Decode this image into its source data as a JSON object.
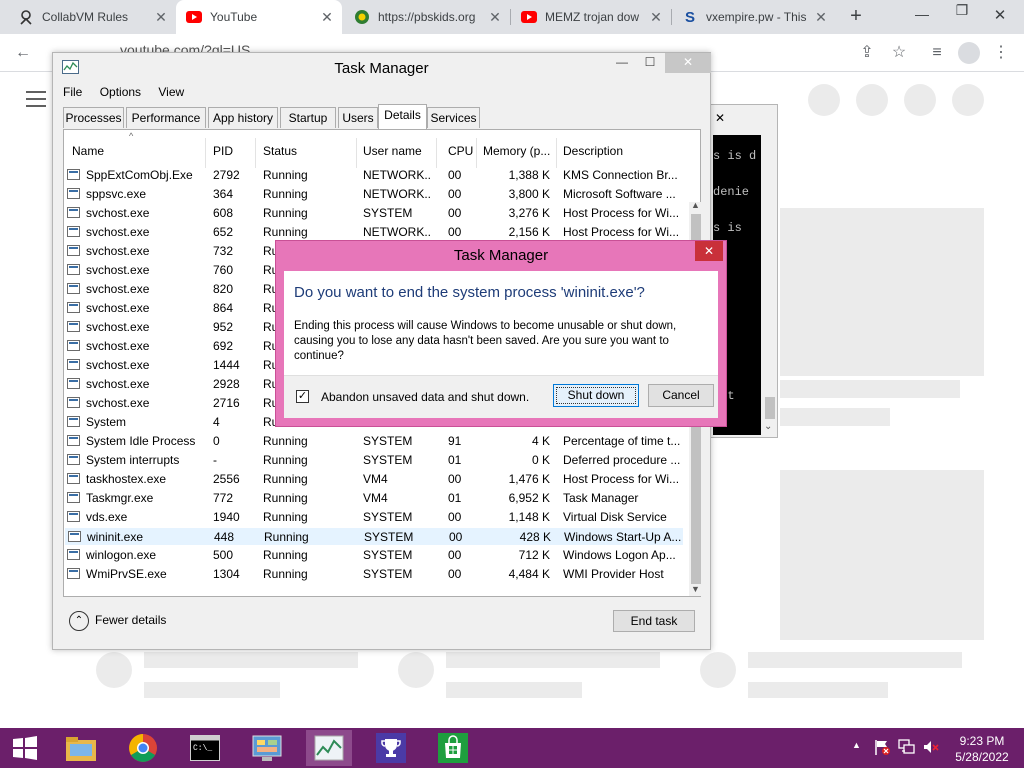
{
  "browser": {
    "tabs": [
      {
        "title": "CollabVM Rules",
        "icon": "collabvm-icon"
      },
      {
        "title": "YouTube",
        "icon": "youtube-icon"
      },
      {
        "title": "https://pbskids.org",
        "icon": "pbskids-icon"
      },
      {
        "title": "MEMZ trojan dow",
        "icon": "youtube-icon"
      },
      {
        "title": "vxempire.pw - This",
        "icon": "vxempire-icon"
      }
    ],
    "new_tab": "+",
    "url": "youtube.com/?gl=US",
    "colors": {
      "tabstrip": "#dfe1e5",
      "active_tab": "#ffffff"
    }
  },
  "task_manager": {
    "title": "Task Manager",
    "menu": [
      "File",
      "Options",
      "View"
    ],
    "tabs": [
      "Processes",
      "Performance",
      "App history",
      "Startup",
      "Users",
      "Details",
      "Services"
    ],
    "selected_tab": "Details",
    "columns": [
      "Name",
      "PID",
      "Status",
      "User name",
      "CPU",
      "Memory (p...",
      "Description"
    ],
    "rows": [
      {
        "name": "SppExtComObj.Exe",
        "pid": "2792",
        "status": "Running",
        "user": "NETWORK...",
        "cpu": "00",
        "mem": "1,388 K",
        "desc": "KMS Connection Br..."
      },
      {
        "name": "sppsvc.exe",
        "pid": "364",
        "status": "Running",
        "user": "NETWORK...",
        "cpu": "00",
        "mem": "3,800 K",
        "desc": "Microsoft Software ..."
      },
      {
        "name": "svchost.exe",
        "pid": "608",
        "status": "Running",
        "user": "SYSTEM",
        "cpu": "00",
        "mem": "3,276 K",
        "desc": "Host Process for Wi..."
      },
      {
        "name": "svchost.exe",
        "pid": "652",
        "status": "Running",
        "user": "NETWORK...",
        "cpu": "00",
        "mem": "2,156 K",
        "desc": "Host Process for Wi..."
      },
      {
        "name": "svchost.exe",
        "pid": "732",
        "status": "Ru",
        "user": "",
        "cpu": "",
        "mem": "",
        "desc": ""
      },
      {
        "name": "svchost.exe",
        "pid": "760",
        "status": "Ru",
        "user": "",
        "cpu": "",
        "mem": "",
        "desc": ""
      },
      {
        "name": "svchost.exe",
        "pid": "820",
        "status": "Ru",
        "user": "",
        "cpu": "",
        "mem": "",
        "desc": ""
      },
      {
        "name": "svchost.exe",
        "pid": "864",
        "status": "Ru",
        "user": "",
        "cpu": "",
        "mem": "",
        "desc": ""
      },
      {
        "name": "svchost.exe",
        "pid": "952",
        "status": "Ru",
        "user": "",
        "cpu": "",
        "mem": "",
        "desc": ""
      },
      {
        "name": "svchost.exe",
        "pid": "692",
        "status": "Ru",
        "user": "",
        "cpu": "",
        "mem": "",
        "desc": ""
      },
      {
        "name": "svchost.exe",
        "pid": "1444",
        "status": "Ru",
        "user": "",
        "cpu": "",
        "mem": "",
        "desc": ""
      },
      {
        "name": "svchost.exe",
        "pid": "2928",
        "status": "Ru",
        "user": "",
        "cpu": "",
        "mem": "",
        "desc": ""
      },
      {
        "name": "svchost.exe",
        "pid": "2716",
        "status": "Ru",
        "user": "",
        "cpu": "",
        "mem": "",
        "desc": ""
      },
      {
        "name": "System",
        "pid": "4",
        "status": "Ru",
        "user": "",
        "cpu": "",
        "mem": "",
        "desc": ""
      },
      {
        "name": "System Idle Process",
        "pid": "0",
        "status": "Running",
        "user": "SYSTEM",
        "cpu": "91",
        "mem": "4 K",
        "desc": "Percentage of time t..."
      },
      {
        "name": "System interrupts",
        "pid": "-",
        "status": "Running",
        "user": "SYSTEM",
        "cpu": "01",
        "mem": "0 K",
        "desc": "Deferred procedure ..."
      },
      {
        "name": "taskhostex.exe",
        "pid": "2556",
        "status": "Running",
        "user": "VM4",
        "cpu": "00",
        "mem": "1,476 K",
        "desc": "Host Process for Wi..."
      },
      {
        "name": "Taskmgr.exe",
        "pid": "772",
        "status": "Running",
        "user": "VM4",
        "cpu": "01",
        "mem": "6,952 K",
        "desc": "Task Manager"
      },
      {
        "name": "vds.exe",
        "pid": "1940",
        "status": "Running",
        "user": "SYSTEM",
        "cpu": "00",
        "mem": "1,148 K",
        "desc": "Virtual Disk Service"
      },
      {
        "name": "wininit.exe",
        "pid": "448",
        "status": "Running",
        "user": "SYSTEM",
        "cpu": "00",
        "mem": "428 K",
        "desc": "Windows Start-Up A..."
      },
      {
        "name": "winlogon.exe",
        "pid": "500",
        "status": "Running",
        "user": "SYSTEM",
        "cpu": "00",
        "mem": "712 K",
        "desc": "Windows Logon Ap..."
      },
      {
        "name": "WmiPrvSE.exe",
        "pid": "1304",
        "status": "Running",
        "user": "SYSTEM",
        "cpu": "00",
        "mem": "4,484 K",
        "desc": "WMI Provider Host"
      }
    ],
    "selected_row": "wininit.exe",
    "fewer_details": "Fewer details",
    "end_task": "End task"
  },
  "cmd": {
    "lines": [
      "s is d",
      "denie",
      "s is",
      "not"
    ]
  },
  "dialog": {
    "title": "Task Manager",
    "heading": "Do you want to end the system process 'wininit.exe'?",
    "body": "Ending this process will cause Windows to become unusable or shut down, causing you to lose any data hasn't been saved. Are you sure you want to continue?",
    "checkbox_label": "Abandon unsaved data and shut down.",
    "checkbox_checked": true,
    "shutdown": "Shut down",
    "cancel": "Cancel",
    "colors": {
      "frame": "#e776b9",
      "heading": "#1e3c78"
    }
  },
  "taskbar": {
    "time": "9:23 PM",
    "date": "5/28/2022",
    "apps": [
      "file-explorer-icon",
      "chrome-icon",
      "cmd-icon",
      "control-panel-icon",
      "task-manager-icon",
      "trophy-icon",
      "store-icon"
    ],
    "color": "#6b1f6a"
  }
}
